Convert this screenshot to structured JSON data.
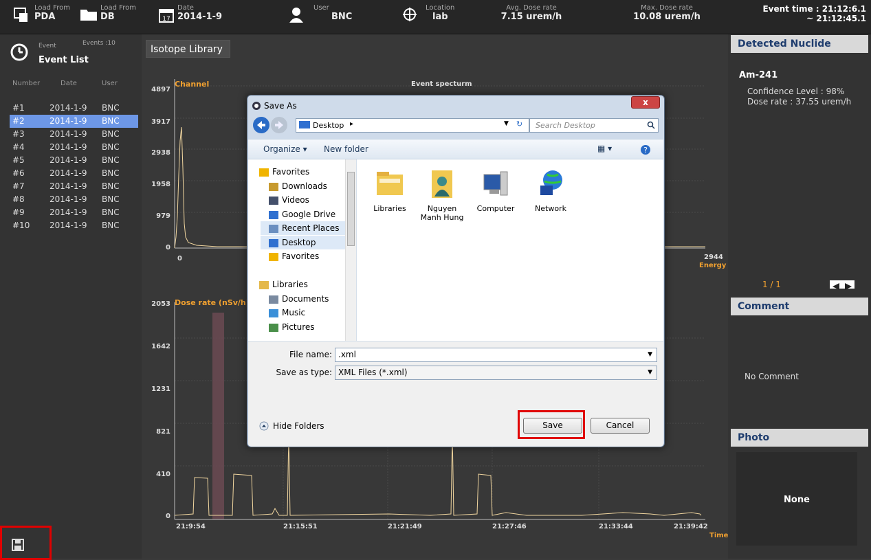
{
  "topbar": {
    "load_pda_small": "Load From",
    "load_pda_big": "PDA",
    "load_db_small": "Load From",
    "load_db_big": "DB",
    "date_small": "Date",
    "date_icon_num": "17",
    "date_value": "2014-1-9",
    "user_small": "User",
    "user_value": "BNC",
    "location_small": "Location",
    "location_value": "lab",
    "avg_small": "Avg. Dose rate",
    "avg_value": "7.15 urem/h",
    "max_small": "Max. Dose rate",
    "max_value": "10.08 urem/h",
    "event_time_line1": "Event time : 21:12:6.1",
    "event_time_line2": "~ 21:12:45.1"
  },
  "left": {
    "event_small": "Event",
    "events_count": "Events :10",
    "event_list_title": "Event List",
    "col_number": "Number",
    "col_date": "Date",
    "col_user": "User",
    "rows": [
      {
        "num": "#1",
        "date": "2014-1-9",
        "user": "BNC"
      },
      {
        "num": "#2",
        "date": "2014-1-9",
        "user": "BNC"
      },
      {
        "num": "#3",
        "date": "2014-1-9",
        "user": "BNC"
      },
      {
        "num": "#4",
        "date": "2014-1-9",
        "user": "BNC"
      },
      {
        "num": "#5",
        "date": "2014-1-9",
        "user": "BNC"
      },
      {
        "num": "#6",
        "date": "2014-1-9",
        "user": "BNC"
      },
      {
        "num": "#7",
        "date": "2014-1-9",
        "user": "BNC"
      },
      {
        "num": "#8",
        "date": "2014-1-9",
        "user": "BNC"
      },
      {
        "num": "#9",
        "date": "2014-1-9",
        "user": "BNC"
      },
      {
        "num": "#10",
        "date": "2014-1-9",
        "user": "BNC"
      }
    ],
    "selected_row_index": 1
  },
  "center": {
    "isotope_library": "Isotope Library",
    "spectrum_title": "Event specturm",
    "spectrum_ylabel": "Channel",
    "spectrum_xlabel": "Energy",
    "spectrum_yticks": [
      "4897",
      "3917",
      "2938",
      "1958",
      "979",
      "0"
    ],
    "spectrum_x0": "0",
    "spectrum_xmax": "2944",
    "dose_ylabel": "Dose rate (nSv/h)",
    "dose_xlabel": "Time",
    "dose_yticks": [
      "2053",
      "1642",
      "1231",
      "821",
      "410",
      "0"
    ],
    "dose_xticks": [
      "21:9:54",
      "21:15:51",
      "21:21:49",
      "21:27:46",
      "21:33:44",
      "21:39:42"
    ]
  },
  "right": {
    "detected_nuclide": "Detected Nuclide",
    "nuclide_name": "Am-241",
    "confidence": "Confidence Level : 98%",
    "dose_rate": "Dose rate : 37.55 urem/h",
    "page": "1 / 1",
    "comment_header": "Comment",
    "comment_text": "No Comment",
    "photo_header": "Photo",
    "photo_text": "None"
  },
  "dialog": {
    "title": "Save As",
    "close": "x",
    "address": "Desktop",
    "search_placeholder": "Search Desktop",
    "organize": "Organize ▾",
    "new_folder": "New folder",
    "nav_items": [
      {
        "label": "Favorites",
        "level": 0
      },
      {
        "label": "Downloads",
        "level": 1
      },
      {
        "label": "Videos",
        "level": 1
      },
      {
        "label": "Google Drive",
        "level": 1
      },
      {
        "label": "Recent Places",
        "level": 1
      },
      {
        "label": "Desktop",
        "level": 1
      },
      {
        "label": "Favorites",
        "level": 1
      },
      {
        "label": "Libraries",
        "level": 0
      },
      {
        "label": "Documents",
        "level": 1
      },
      {
        "label": "Music",
        "level": 1
      },
      {
        "label": "Pictures",
        "level": 1
      }
    ],
    "files": [
      {
        "label": "Libraries",
        "icon": "libraries-icon"
      },
      {
        "label": "Nguyen Manh Hung",
        "icon": "user-folder-icon"
      },
      {
        "label": "Computer",
        "icon": "computer-icon"
      },
      {
        "label": "Network",
        "icon": "network-icon"
      }
    ],
    "file_name_label": "File name:",
    "file_name_value": ".xml",
    "save_type_label": "Save as type:",
    "save_type_value": "XML Files (*.xml)",
    "hide_folders": "Hide Folders",
    "save_button": "Save",
    "cancel_button": "Cancel"
  },
  "colors": {
    "accent_orange": "#f0a030",
    "selected_row": "#6d97e6",
    "highlight_red": "#e00000",
    "plot_line": "#f2d7a0"
  }
}
